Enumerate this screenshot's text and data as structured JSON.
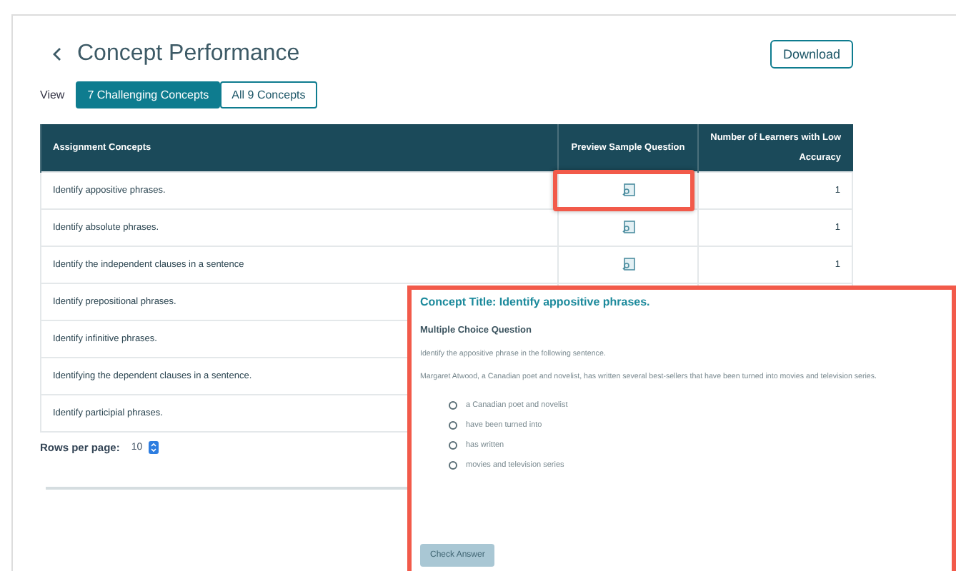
{
  "page": {
    "title": "Concept Performance",
    "download": "Download"
  },
  "view": {
    "label": "View",
    "options": [
      {
        "label": "7 Challenging Concepts",
        "selected": true
      },
      {
        "label": "All 9 Concepts",
        "selected": false
      }
    ]
  },
  "table": {
    "columns": [
      "Assignment Concepts",
      "Preview Sample Question",
      "Number of Learners with Low Accuracy"
    ],
    "rows": [
      {
        "concept": "Identify appositive phrases.",
        "count": "1",
        "highlighted": true
      },
      {
        "concept": "Identify absolute phrases.",
        "count": "1",
        "highlighted": false
      },
      {
        "concept": "Identify the independent clauses in a sentence",
        "count": "1",
        "highlighted": false
      },
      {
        "concept": "Identify prepositional phrases."
      },
      {
        "concept": "Identify infinitive phrases."
      },
      {
        "concept": "Identifying the dependent clauses in a sentence."
      },
      {
        "concept": "Identify participial phrases."
      }
    ]
  },
  "pagination": {
    "label": "Rows per page:",
    "value": "10"
  },
  "preview": {
    "title": "Concept Title: Identify appositive phrases.",
    "type": "Multiple Choice Question",
    "prompt": "Identify the appositive phrase in the following sentence.",
    "sentence": "Margaret Atwood, a Canadian poet and novelist, has written several best-sellers that have been turned into movies and television series.",
    "options": [
      {
        "label": "a Canadian poet and novelist",
        "selected": false
      },
      {
        "label": "have been turned into",
        "selected": false
      },
      {
        "label": "has written",
        "selected": false
      },
      {
        "label": "movies and television series",
        "selected": false
      }
    ],
    "button": {
      "label": "Check Answer",
      "disabled": true
    }
  }
}
